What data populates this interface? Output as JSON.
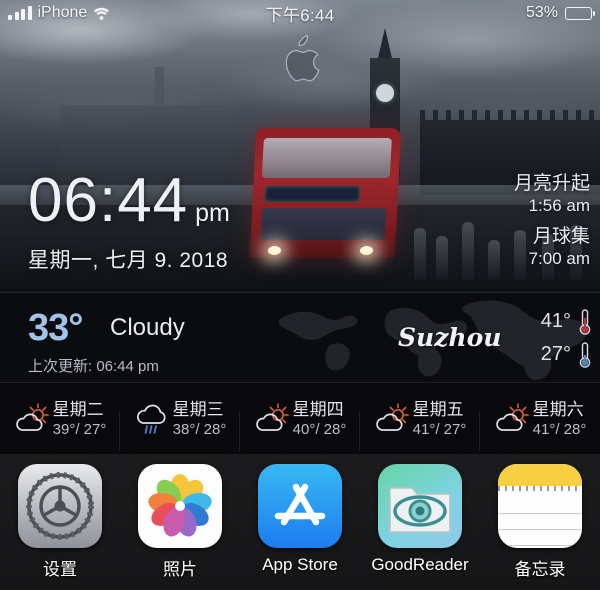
{
  "status_bar": {
    "signal_icon": "signal-bars-icon",
    "carrier": "iPhone",
    "wifi_icon": "wifi-icon",
    "time": "下午6:44",
    "battery_percent": "53%",
    "battery_level": 53,
    "battery_icon": "battery-icon"
  },
  "wallpaper": {
    "apple_logo_icon": "apple-logo-icon",
    "scene": "london-bus-bigben"
  },
  "lock_clock": {
    "time": "06:44",
    "ampm": "pm",
    "date": "星期一, 七月 9. 2018"
  },
  "moon": {
    "rise_label": "月亮升起",
    "rise_time": "1:56 am",
    "set_label": "月球集",
    "set_time": "7:00 am"
  },
  "weather": {
    "temperature": "33°",
    "condition": "Cloudy",
    "updated": "上次更新: 06:44 pm",
    "city": "Suzhou",
    "high": "41°",
    "low": "27°",
    "high_icon": "thermometer-hot-icon",
    "low_icon": "thermometer-cold-icon",
    "map_icon": "world-map-icon",
    "temp_color": "#9fc4e8"
  },
  "forecast": [
    {
      "day": "星期二",
      "high": "39°",
      "low": "27°",
      "temps": "39°/ 27°",
      "icon": "sun-behind-cloud-icon"
    },
    {
      "day": "星期三",
      "high": "38°",
      "low": "28°",
      "temps": "38°/ 28°",
      "icon": "rain-cloud-icon"
    },
    {
      "day": "星期四",
      "high": "40°",
      "low": "28°",
      "temps": "40°/ 28°",
      "icon": "sun-behind-cloud-icon"
    },
    {
      "day": "星期五",
      "high": "41°",
      "low": "27°",
      "temps": "41°/ 27°",
      "icon": "sun-behind-cloud-icon"
    },
    {
      "day": "星期六",
      "high": "41°",
      "low": "28°",
      "temps": "41°/ 28°",
      "icon": "sun-behind-cloud-icon"
    }
  ],
  "dock": [
    {
      "label": "设置",
      "icon": "settings-gear-icon"
    },
    {
      "label": "照片",
      "icon": "photos-pinwheel-icon"
    },
    {
      "label": "App Store",
      "icon": "app-store-icon"
    },
    {
      "label": "GoodReader",
      "icon": "goodreader-eye-icon"
    },
    {
      "label": "备忘录",
      "icon": "notes-icon"
    }
  ]
}
